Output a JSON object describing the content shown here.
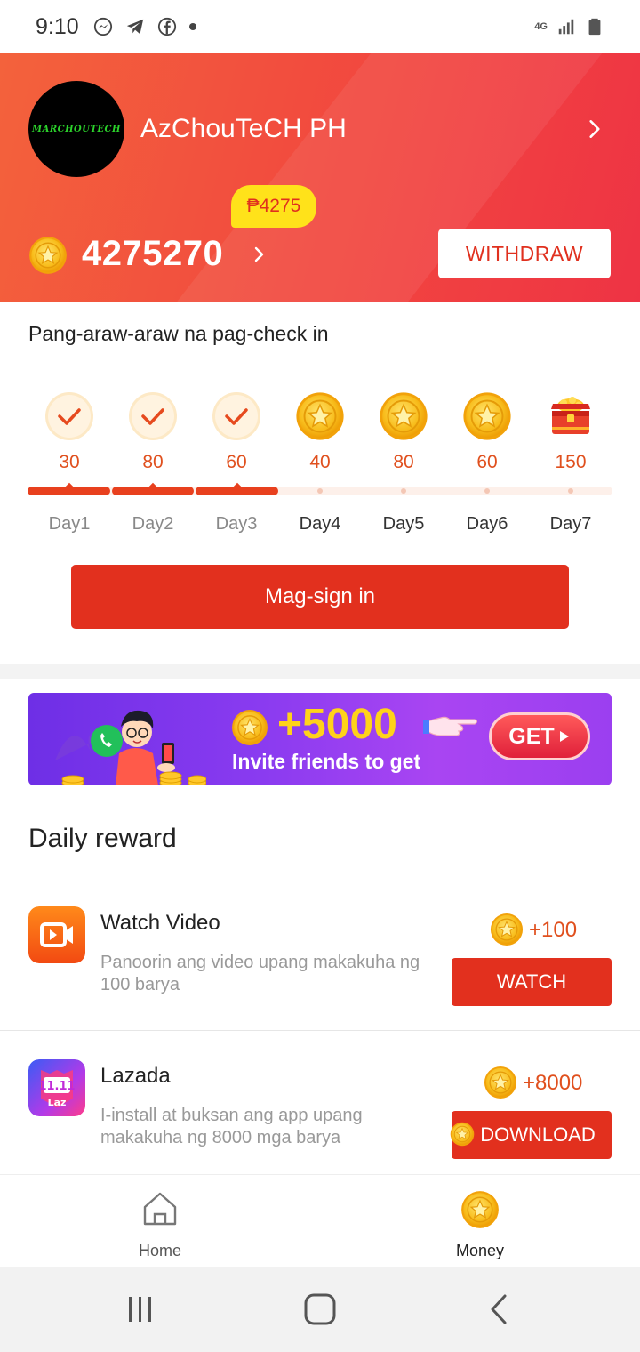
{
  "status_bar": {
    "time": "9:10",
    "network": "4G"
  },
  "profile": {
    "avatar_text": "MARCHOUTECH",
    "username": "AzChouTeCH PH",
    "peso_badge": "₱4275",
    "coin_balance": "4275270",
    "withdraw_label": "WITHDRAW"
  },
  "checkin": {
    "title": "Pang-araw-araw na pag-check in",
    "days": [
      {
        "label": "Day1",
        "points": "30",
        "state": "done"
      },
      {
        "label": "Day2",
        "points": "80",
        "state": "done"
      },
      {
        "label": "Day3",
        "points": "60",
        "state": "done"
      },
      {
        "label": "Day4",
        "points": "40",
        "state": "coin"
      },
      {
        "label": "Day5",
        "points": "80",
        "state": "coin"
      },
      {
        "label": "Day6",
        "points": "60",
        "state": "coin"
      },
      {
        "label": "Day7",
        "points": "150",
        "state": "chest"
      }
    ],
    "completed_days": 3,
    "button_label": "Mag-sign in"
  },
  "banner": {
    "amount": "+5000",
    "text": "Invite friends to get",
    "button_label": "GET"
  },
  "daily_reward": {
    "title": "Daily reward",
    "tasks": [
      {
        "title": "Watch Video",
        "description": "Panoorin ang video upang makakuha ng 100 barya",
        "reward": "+100",
        "button_label": "WATCH",
        "icon": "video-app-icon"
      },
      {
        "title": "Lazada",
        "description": "I-install at buksan ang app upang makakuha ng 8000 mga barya",
        "reward": "+8000",
        "button_label": "DOWNLOAD",
        "icon": "lazada-app-icon"
      }
    ]
  },
  "bottom_nav": {
    "items": [
      {
        "label": "Home",
        "icon": "home-icon",
        "active": false
      },
      {
        "label": "Money",
        "icon": "coin-icon",
        "active": true
      }
    ]
  },
  "colors": {
    "primary": "#e2301e",
    "header_start": "#f3623c",
    "header_end": "#ee3344",
    "coin": "#f7b500",
    "banner": "#8a3bf0"
  }
}
